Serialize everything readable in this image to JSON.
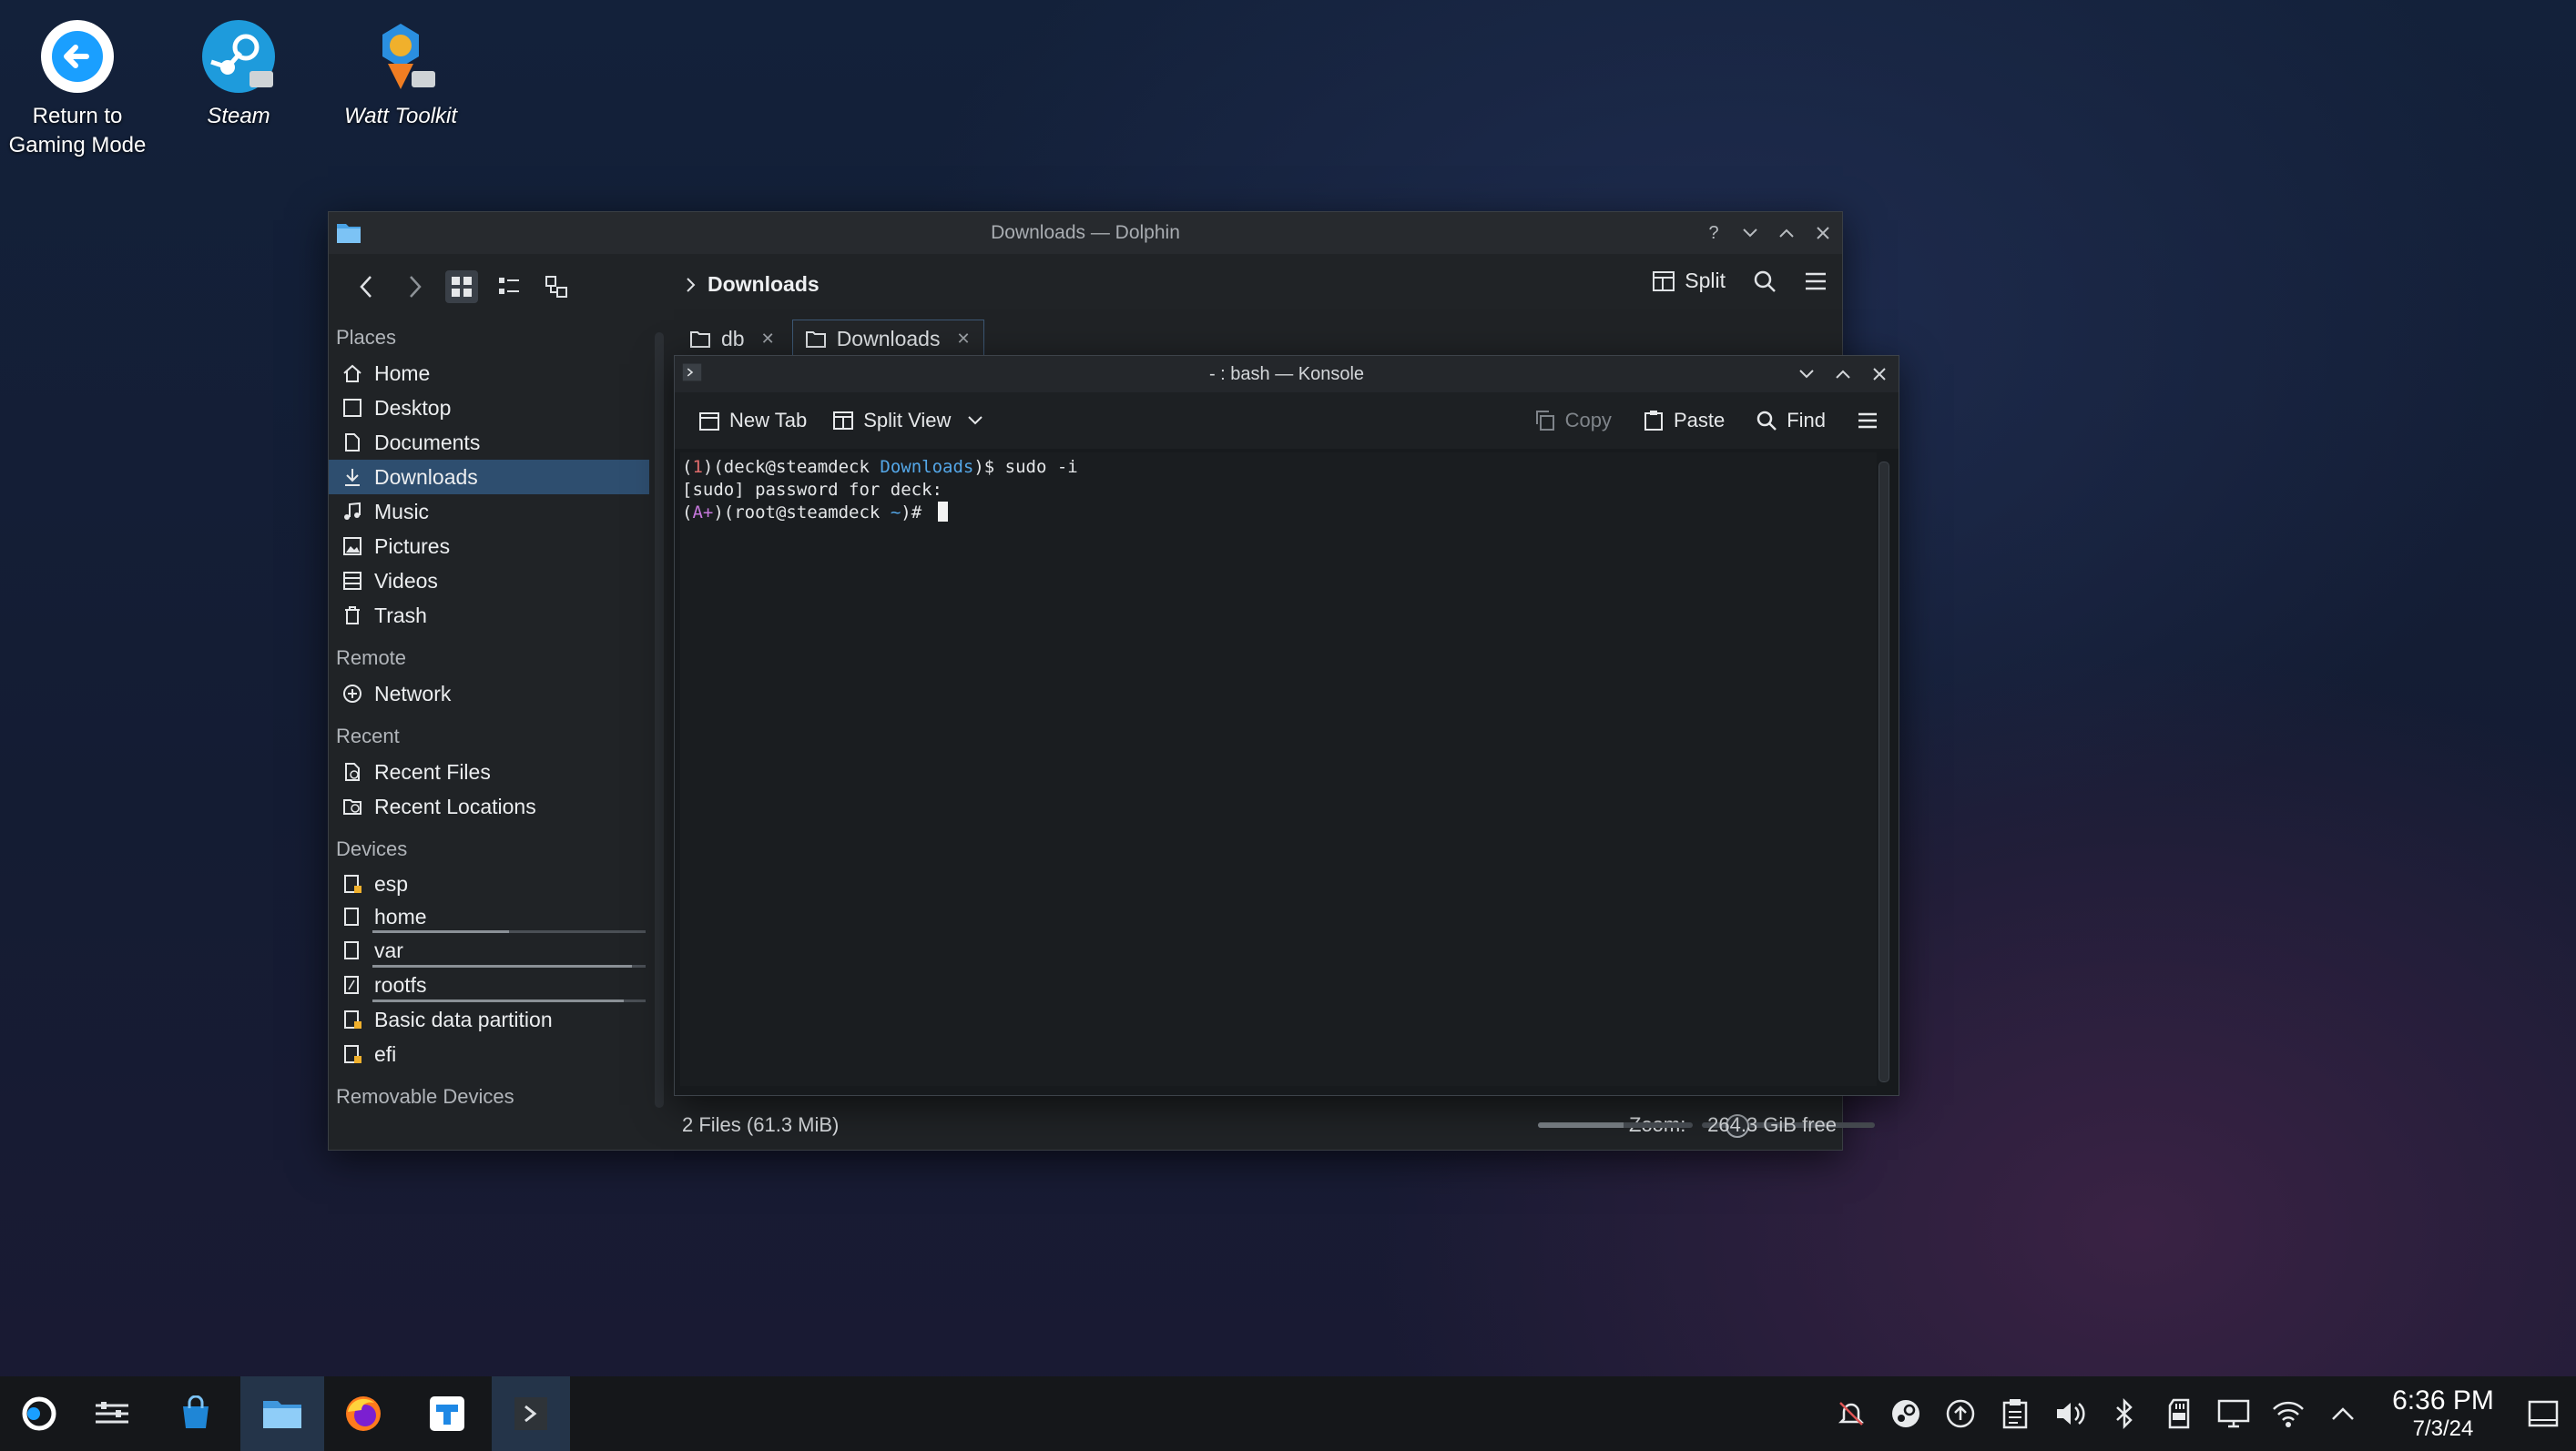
{
  "desktop": {
    "icons": [
      {
        "label_line1": "Return to",
        "label_line2": "Gaming Mode"
      },
      {
        "label": "Steam"
      },
      {
        "label": "Watt Toolkit"
      }
    ]
  },
  "dolphin": {
    "title": "Downloads — Dolphin",
    "breadcrumb": "Downloads",
    "split_label": "Split",
    "sections": {
      "places": "Places",
      "remote": "Remote",
      "recent": "Recent",
      "devices": "Devices",
      "removable": "Removable Devices"
    },
    "places": [
      "Home",
      "Desktop",
      "Documents",
      "Downloads",
      "Music",
      "Pictures",
      "Videos",
      "Trash"
    ],
    "remote": [
      "Network"
    ],
    "recent": [
      "Recent Files",
      "Recent Locations"
    ],
    "devices": [
      {
        "label": "esp"
      },
      {
        "label": "home",
        "usage": 0.5
      },
      {
        "label": "var",
        "usage": 0.95
      },
      {
        "label": "rootfs",
        "usage": 0.92
      },
      {
        "label": "Basic data partition"
      },
      {
        "label": "efi"
      }
    ],
    "tabs": [
      {
        "label": "db"
      },
      {
        "label": "Downloads"
      }
    ],
    "status": {
      "files": "2 Files (61.3 MiB)",
      "zoom_label": "Zoom:",
      "zoom_level": 0.15,
      "free": "264.3 GiB free",
      "used_fraction": 0.55
    }
  },
  "konsole": {
    "title": "- : bash — Konsole",
    "toolbar": {
      "new_tab": "New Tab",
      "split_view": "Split View",
      "copy": "Copy",
      "paste": "Paste",
      "find": "Find"
    },
    "terminal": {
      "line1": {
        "open": "(",
        "num": "1",
        "close_user": ")(deck@steamdeck ",
        "dir": "Downloads",
        "prompt": ")$ ",
        "cmd": "sudo -i"
      },
      "line2": "[sudo] password for deck:",
      "line3": {
        "open": "(",
        "tag": "A+",
        "close_user": ")(root@steamdeck ",
        "dir": "~",
        "prompt": ")# "
      }
    }
  },
  "taskbar": {
    "time": "6:36 PM",
    "date": "7/3/24"
  }
}
